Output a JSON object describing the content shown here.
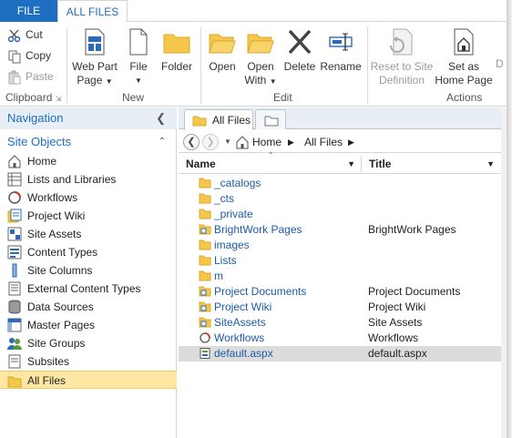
{
  "tabs": {
    "file": "FILE",
    "all_files": "ALL FILES"
  },
  "ribbon": {
    "clipboard": {
      "cut": "Cut",
      "copy": "Copy",
      "paste": "Paste",
      "group_label": "Clipboard"
    },
    "new": {
      "web_part_page_1": "Web Part",
      "web_part_page_2": "Page",
      "file": "File",
      "folder": "Folder",
      "group_label": "New"
    },
    "edit": {
      "open": "Open",
      "open_with_1": "Open",
      "open_with_2": "With",
      "delete": "Delete",
      "rename": "Rename",
      "group_label": "Edit"
    },
    "actions": {
      "reset_1": "Reset to Site",
      "reset_2": "Definition",
      "set_home_1": "Set as",
      "set_home_2": "Home Page",
      "group_label": "Actions",
      "cut_off": "D"
    }
  },
  "nav": {
    "header": "Navigation",
    "section": "Site Objects",
    "items": [
      {
        "label": "Home",
        "icon": "home-icon"
      },
      {
        "label": "Lists and Libraries",
        "icon": "list-icon"
      },
      {
        "label": "Workflows",
        "icon": "workflow-icon"
      },
      {
        "label": "Project Wiki",
        "icon": "wiki-icon"
      },
      {
        "label": "Site Assets",
        "icon": "assets-icon"
      },
      {
        "label": "Content Types",
        "icon": "content-types-icon"
      },
      {
        "label": "Site Columns",
        "icon": "column-icon"
      },
      {
        "label": "External Content Types",
        "icon": "external-content-icon"
      },
      {
        "label": "Data Sources",
        "icon": "database-icon"
      },
      {
        "label": "Master Pages",
        "icon": "master-page-icon"
      },
      {
        "label": "Site Groups",
        "icon": "group-icon"
      },
      {
        "label": "Subsites",
        "icon": "subsite-icon"
      },
      {
        "label": "All Files",
        "icon": "folder-icon",
        "selected": true
      }
    ]
  },
  "doc_tab": {
    "label": "All Files"
  },
  "breadcrumb": {
    "home": "Home",
    "current": "All Files"
  },
  "columns": {
    "name": "Name",
    "title": "Title"
  },
  "files": [
    {
      "name": "_catalogs",
      "title": "",
      "type": "folder"
    },
    {
      "name": "_cts",
      "title": "",
      "type": "folder"
    },
    {
      "name": "_private",
      "title": "",
      "type": "folder"
    },
    {
      "name": "BrightWork Pages",
      "title": "BrightWork Pages",
      "type": "library"
    },
    {
      "name": "images",
      "title": "",
      "type": "folder"
    },
    {
      "name": "Lists",
      "title": "",
      "type": "folder"
    },
    {
      "name": "m",
      "title": "",
      "type": "folder"
    },
    {
      "name": "Project Documents",
      "title": "Project Documents",
      "type": "library"
    },
    {
      "name": "Project Wiki",
      "title": "Project Wiki",
      "type": "library"
    },
    {
      "name": "SiteAssets",
      "title": "Site Assets",
      "type": "library"
    },
    {
      "name": "Workflows",
      "title": "Workflows",
      "type": "workflow"
    },
    {
      "name": "default.aspx",
      "title": "default.aspx",
      "type": "page",
      "selected": true
    }
  ],
  "colors": {
    "accent": "#1e6fc1",
    "selection": "#fde7a3",
    "folder": "#f5c74a"
  }
}
